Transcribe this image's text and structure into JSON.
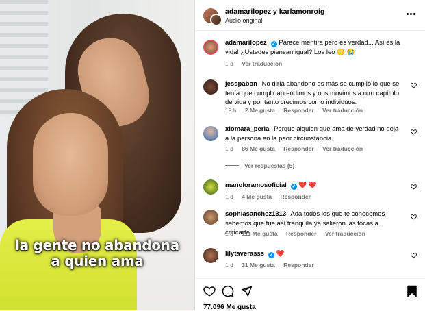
{
  "media": {
    "caption_line1": "la gente no abandona",
    "caption_line2": "a quien ama"
  },
  "header": {
    "names": "adamarilopez y karlamonroig",
    "audio": "Audio original"
  },
  "post": {
    "user": "adamarilopez",
    "text": "Parece mentira pero es verdad... Así es la vida! ¿Ustedes piensan igual? Los leo 🙁 😭",
    "age": "1 d",
    "see_translation": "Ver traducción"
  },
  "comments": [
    {
      "user": "jesspabon",
      "text": "No diría abandono es más se cumplió lo que se tenía que cumplir aprendimos y nos movimos a otro capítulo de vida y por tanto crecimos como individuos.",
      "age": "19 h",
      "likes": "2 Me gusta",
      "reply": "Responder",
      "see_translation": "Ver traducción"
    },
    {
      "user": "xiomara_perla",
      "text": "Porque alguien que ama de verdad no deja a la persona en la peor circunstancia",
      "age": "1 d",
      "likes": "86 Me gusta",
      "reply": "Responder",
      "see_translation": "Ver traducción",
      "view_replies": "Ver respuestas (5)"
    },
    {
      "user": "manoloramosoficial",
      "text": "❤️ ❤️",
      "age": "1 d",
      "likes": "4 Me gusta",
      "reply": "Responder"
    },
    {
      "user": "sophiasanchez1313",
      "text": "Ada todos los que te conocemos sabemos que fue así tranquila ya salieron las focas a criticarte",
      "age": "1 d",
      "likes": "111 Me gusta",
      "reply": "Responder",
      "see_translation": "Ver traducción"
    },
    {
      "user": "lilytaverasss",
      "text": "❤️",
      "age": "1 d",
      "likes": "31 Me gusta",
      "reply": "Responder"
    }
  ],
  "footer": {
    "likes": "77.096 Me gusta"
  },
  "icons": {
    "more": "more-options-icon",
    "like": "heart-icon",
    "comment": "comment-icon",
    "share": "send-icon",
    "save": "bookmark-icon",
    "verified": "verified-badge-icon"
  },
  "colors": {
    "verified": "#0095f6",
    "muted": "#737373",
    "heart_red": "#ed4956"
  }
}
